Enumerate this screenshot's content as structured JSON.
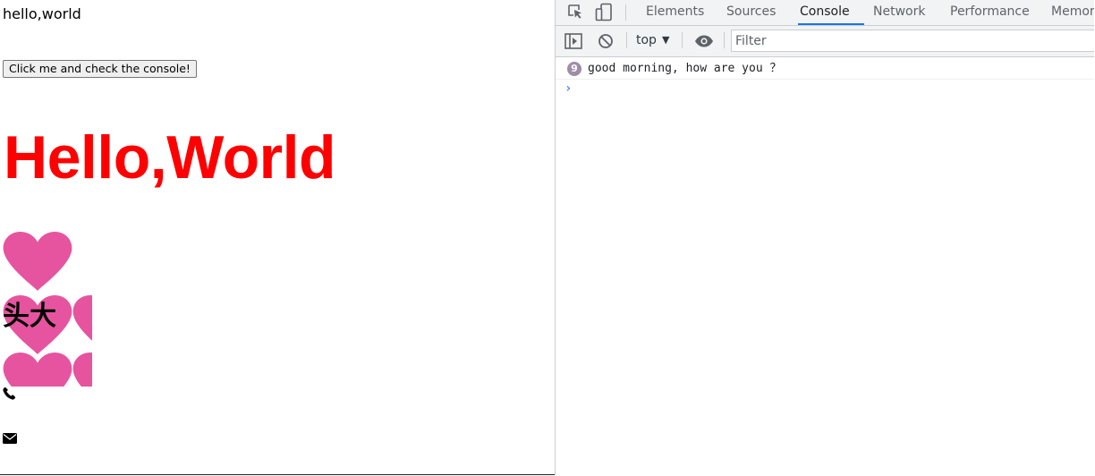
{
  "page": {
    "text": "hello,world",
    "button_label": "Click me and check the console!",
    "heading": "Hello,World",
    "label": "头大",
    "colors": {
      "heading": "#ff0000",
      "heart": "#e6549f"
    },
    "icons": [
      "heart-icon",
      "phone-icon",
      "envelope-icon"
    ]
  },
  "devtools": {
    "tabs": [
      {
        "label": "Elements",
        "active": false
      },
      {
        "label": "Sources",
        "active": false
      },
      {
        "label": "Console",
        "active": true
      },
      {
        "label": "Network",
        "active": false
      },
      {
        "label": "Performance",
        "active": false
      },
      {
        "label": "Memor",
        "active": false
      }
    ],
    "toolbar": {
      "context": "top",
      "filter_placeholder": "Filter",
      "filter_value": ""
    },
    "console": {
      "messages": [
        {
          "count": "9",
          "text": "good morning, how are you ？"
        }
      ],
      "prompt": "›"
    },
    "colors": {
      "accent": "#1a73e8",
      "badge": "#9e8ca8",
      "prompt": "#4a89f3"
    }
  }
}
